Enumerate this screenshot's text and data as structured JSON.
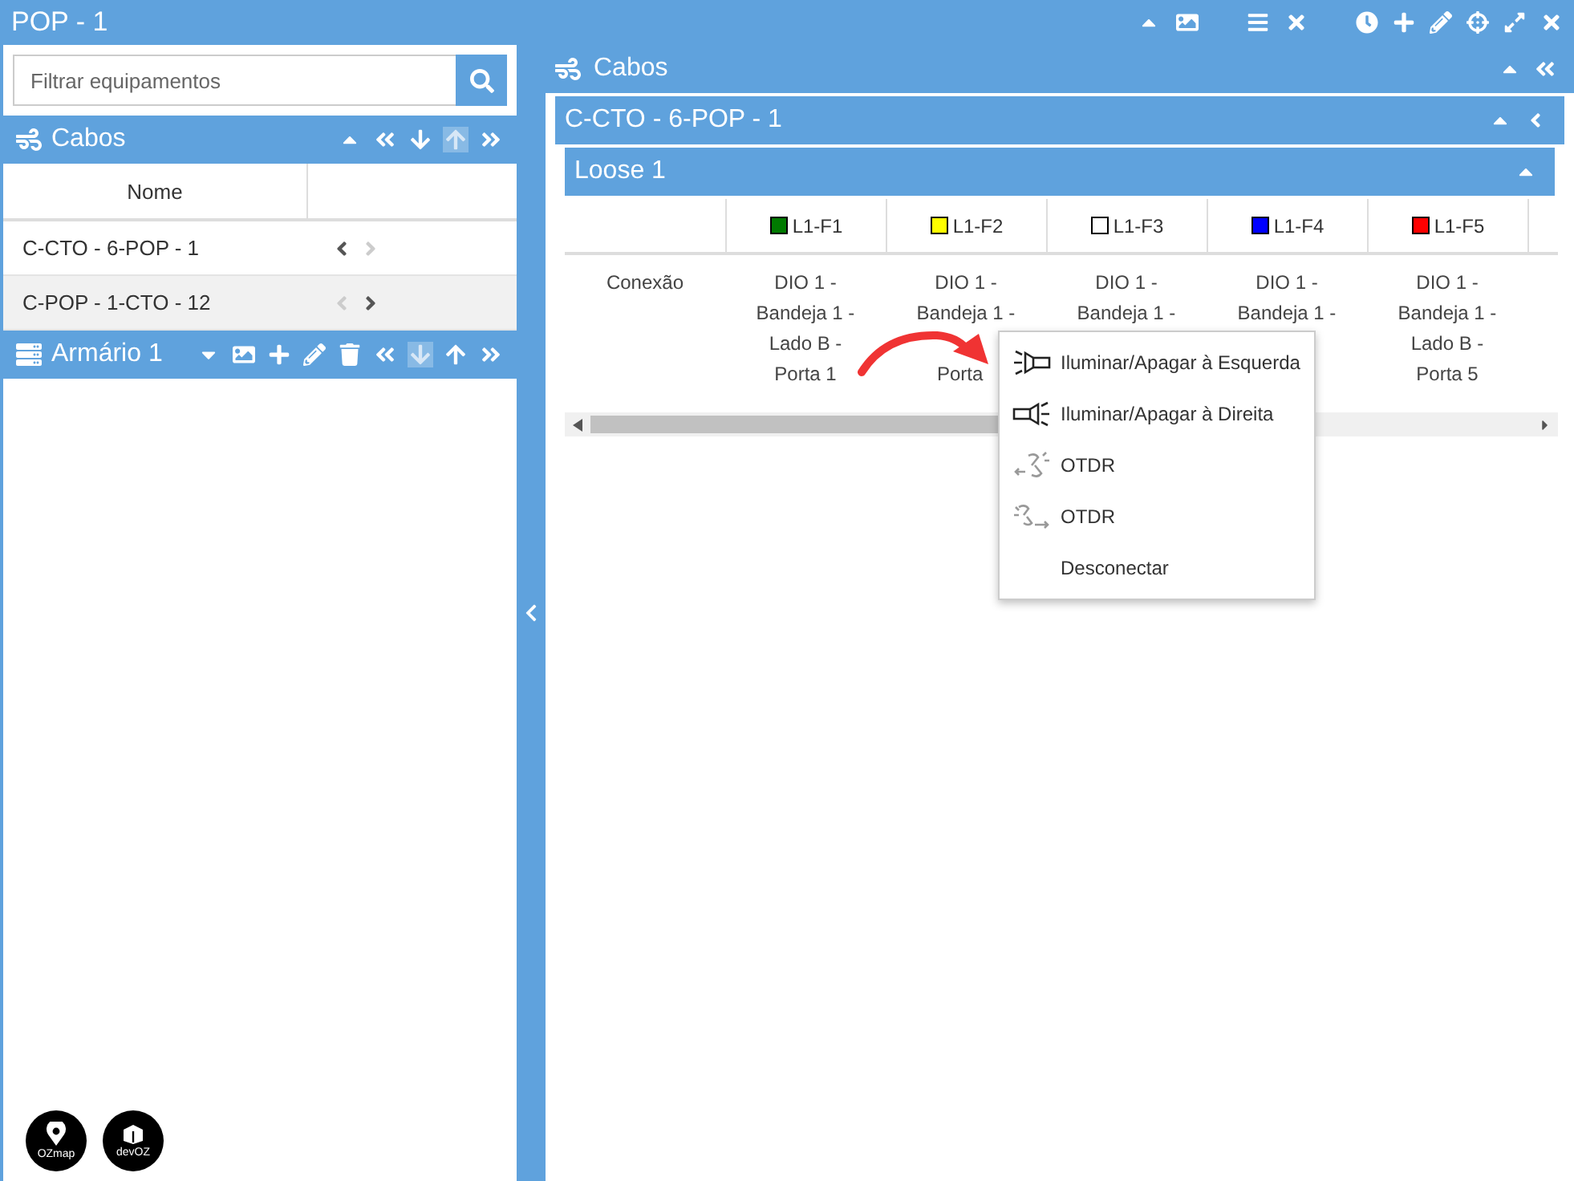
{
  "window": {
    "title": "POP - 1",
    "tools": [
      {
        "kind": "caret-up"
      },
      {
        "kind": "image"
      },
      {
        "kind": "list"
      },
      {
        "kind": "close"
      }
    ],
    "actions": [
      {
        "kind": "clock"
      },
      {
        "kind": "plus"
      },
      {
        "kind": "pencil"
      },
      {
        "kind": "crosshairs"
      },
      {
        "kind": "expand"
      },
      {
        "kind": "close"
      }
    ]
  },
  "left": {
    "search": {
      "placeholder": "Filtrar equipamentos"
    },
    "cables": {
      "title": "Cabos",
      "icons": [
        {
          "kind": "caret-up",
          "disabled": false
        },
        {
          "kind": "double-left",
          "disabled": false
        },
        {
          "kind": "arrow-down",
          "disabled": false
        },
        {
          "kind": "arrow-up",
          "disabled": true
        },
        {
          "kind": "double-right",
          "disabled": false
        }
      ],
      "columns": [
        "Nome"
      ],
      "rows": [
        {
          "name": "C-CTO - 6-POP - 1",
          "selected": false,
          "can_move_left": true,
          "can_move_right": false
        },
        {
          "name": "C-POP - 1-CTO - 12",
          "selected": true,
          "can_move_left": false,
          "can_move_right": true
        }
      ]
    },
    "cabinet": {
      "title": "Armário 1",
      "icons": [
        {
          "kind": "caret-down",
          "disabled": false
        },
        {
          "kind": "image",
          "disabled": false
        },
        {
          "kind": "plus",
          "disabled": false
        },
        {
          "kind": "pencil",
          "disabled": false
        },
        {
          "kind": "trash",
          "disabled": false
        },
        {
          "kind": "double-left",
          "disabled": false
        },
        {
          "kind": "arrow-down",
          "disabled": true
        },
        {
          "kind": "arrow-up",
          "disabled": false
        },
        {
          "kind": "double-right",
          "disabled": false
        }
      ]
    },
    "logos": [
      {
        "label": "OZmap",
        "kind": "pin"
      },
      {
        "label": "devOZ",
        "kind": "box"
      }
    ]
  },
  "right": {
    "title": "Cabos",
    "cable": {
      "title": "C-CTO - 6-POP - 1"
    },
    "loose": {
      "title": "Loose 1"
    },
    "columns": [
      {
        "label": "L1-F1",
        "color": "#007a00"
      },
      {
        "label": "L1-F2",
        "color": "#ffff00"
      },
      {
        "label": "L1-F3",
        "color": "#ffffff"
      },
      {
        "label": "L1-F4",
        "color": "#0000ff"
      },
      {
        "label": "L1-F5",
        "color": "#ff0000"
      }
    ],
    "row": {
      "label": "Conexão",
      "cells": [
        [
          "DIO 1 -",
          "Bandeja 1 -",
          "Lado B -",
          "Porta 1"
        ],
        [
          "DIO 1 -",
          "Bandeja 1 -",
          "Porta"
        ],
        [
          "DIO 1 -",
          "Bandeja 1 -"
        ],
        [
          "DIO 1 -",
          "Bandeja 1 -"
        ],
        [
          "DIO 1 -",
          "Bandeja 1 -",
          "Lado B -",
          "Porta 5"
        ]
      ]
    }
  },
  "context_menu": {
    "items": [
      {
        "label": "Iluminar/Apagar à Esquerda"
      },
      {
        "label": "Iluminar/Apagar à Direita"
      },
      {
        "label": "OTDR"
      },
      {
        "label": "OTDR"
      },
      {
        "label": "Desconectar"
      }
    ]
  }
}
